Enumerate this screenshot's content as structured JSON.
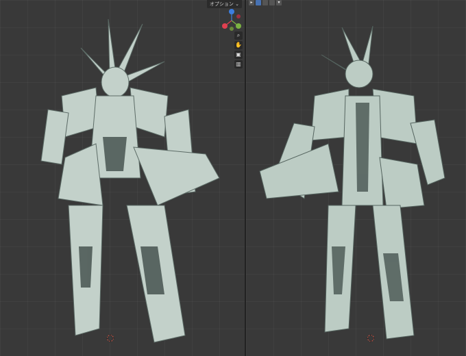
{
  "viewport_left": {
    "options_label": "オプション ⌄",
    "gizmo": {
      "axes": [
        {
          "name": "x-axis",
          "label": "X",
          "color": "#e04050"
        },
        {
          "name": "y-axis",
          "label": "Y",
          "color": "#7cb342"
        },
        {
          "name": "z-axis",
          "label": "Z",
          "color": "#3d7ee0"
        }
      ]
    },
    "nav_buttons": [
      {
        "name": "zoom-icon",
        "glyph": "⌕"
      },
      {
        "name": "pan-hand-icon",
        "glyph": "✋"
      },
      {
        "name": "camera-icon",
        "glyph": "▣"
      },
      {
        "name": "grid-icon",
        "glyph": "▥"
      }
    ]
  },
  "viewport_right": {
    "header_tools": [
      {
        "name": "select-tool-icon",
        "glyph": "▸",
        "active": false
      },
      {
        "name": "solid-shading-icon",
        "glyph": "",
        "active": true
      },
      {
        "name": "material-shading-icon",
        "glyph": "",
        "active": false
      },
      {
        "name": "render-shading-icon",
        "glyph": "",
        "active": false
      },
      {
        "name": "dropdown-icon",
        "glyph": "▾",
        "active": false
      }
    ]
  },
  "colors": {
    "background": "#393939",
    "model_light": "#c9d6cf",
    "model_mid": "#8c9b95",
    "model_dark": "#3d4a47",
    "cursor_red": "#d05040"
  }
}
